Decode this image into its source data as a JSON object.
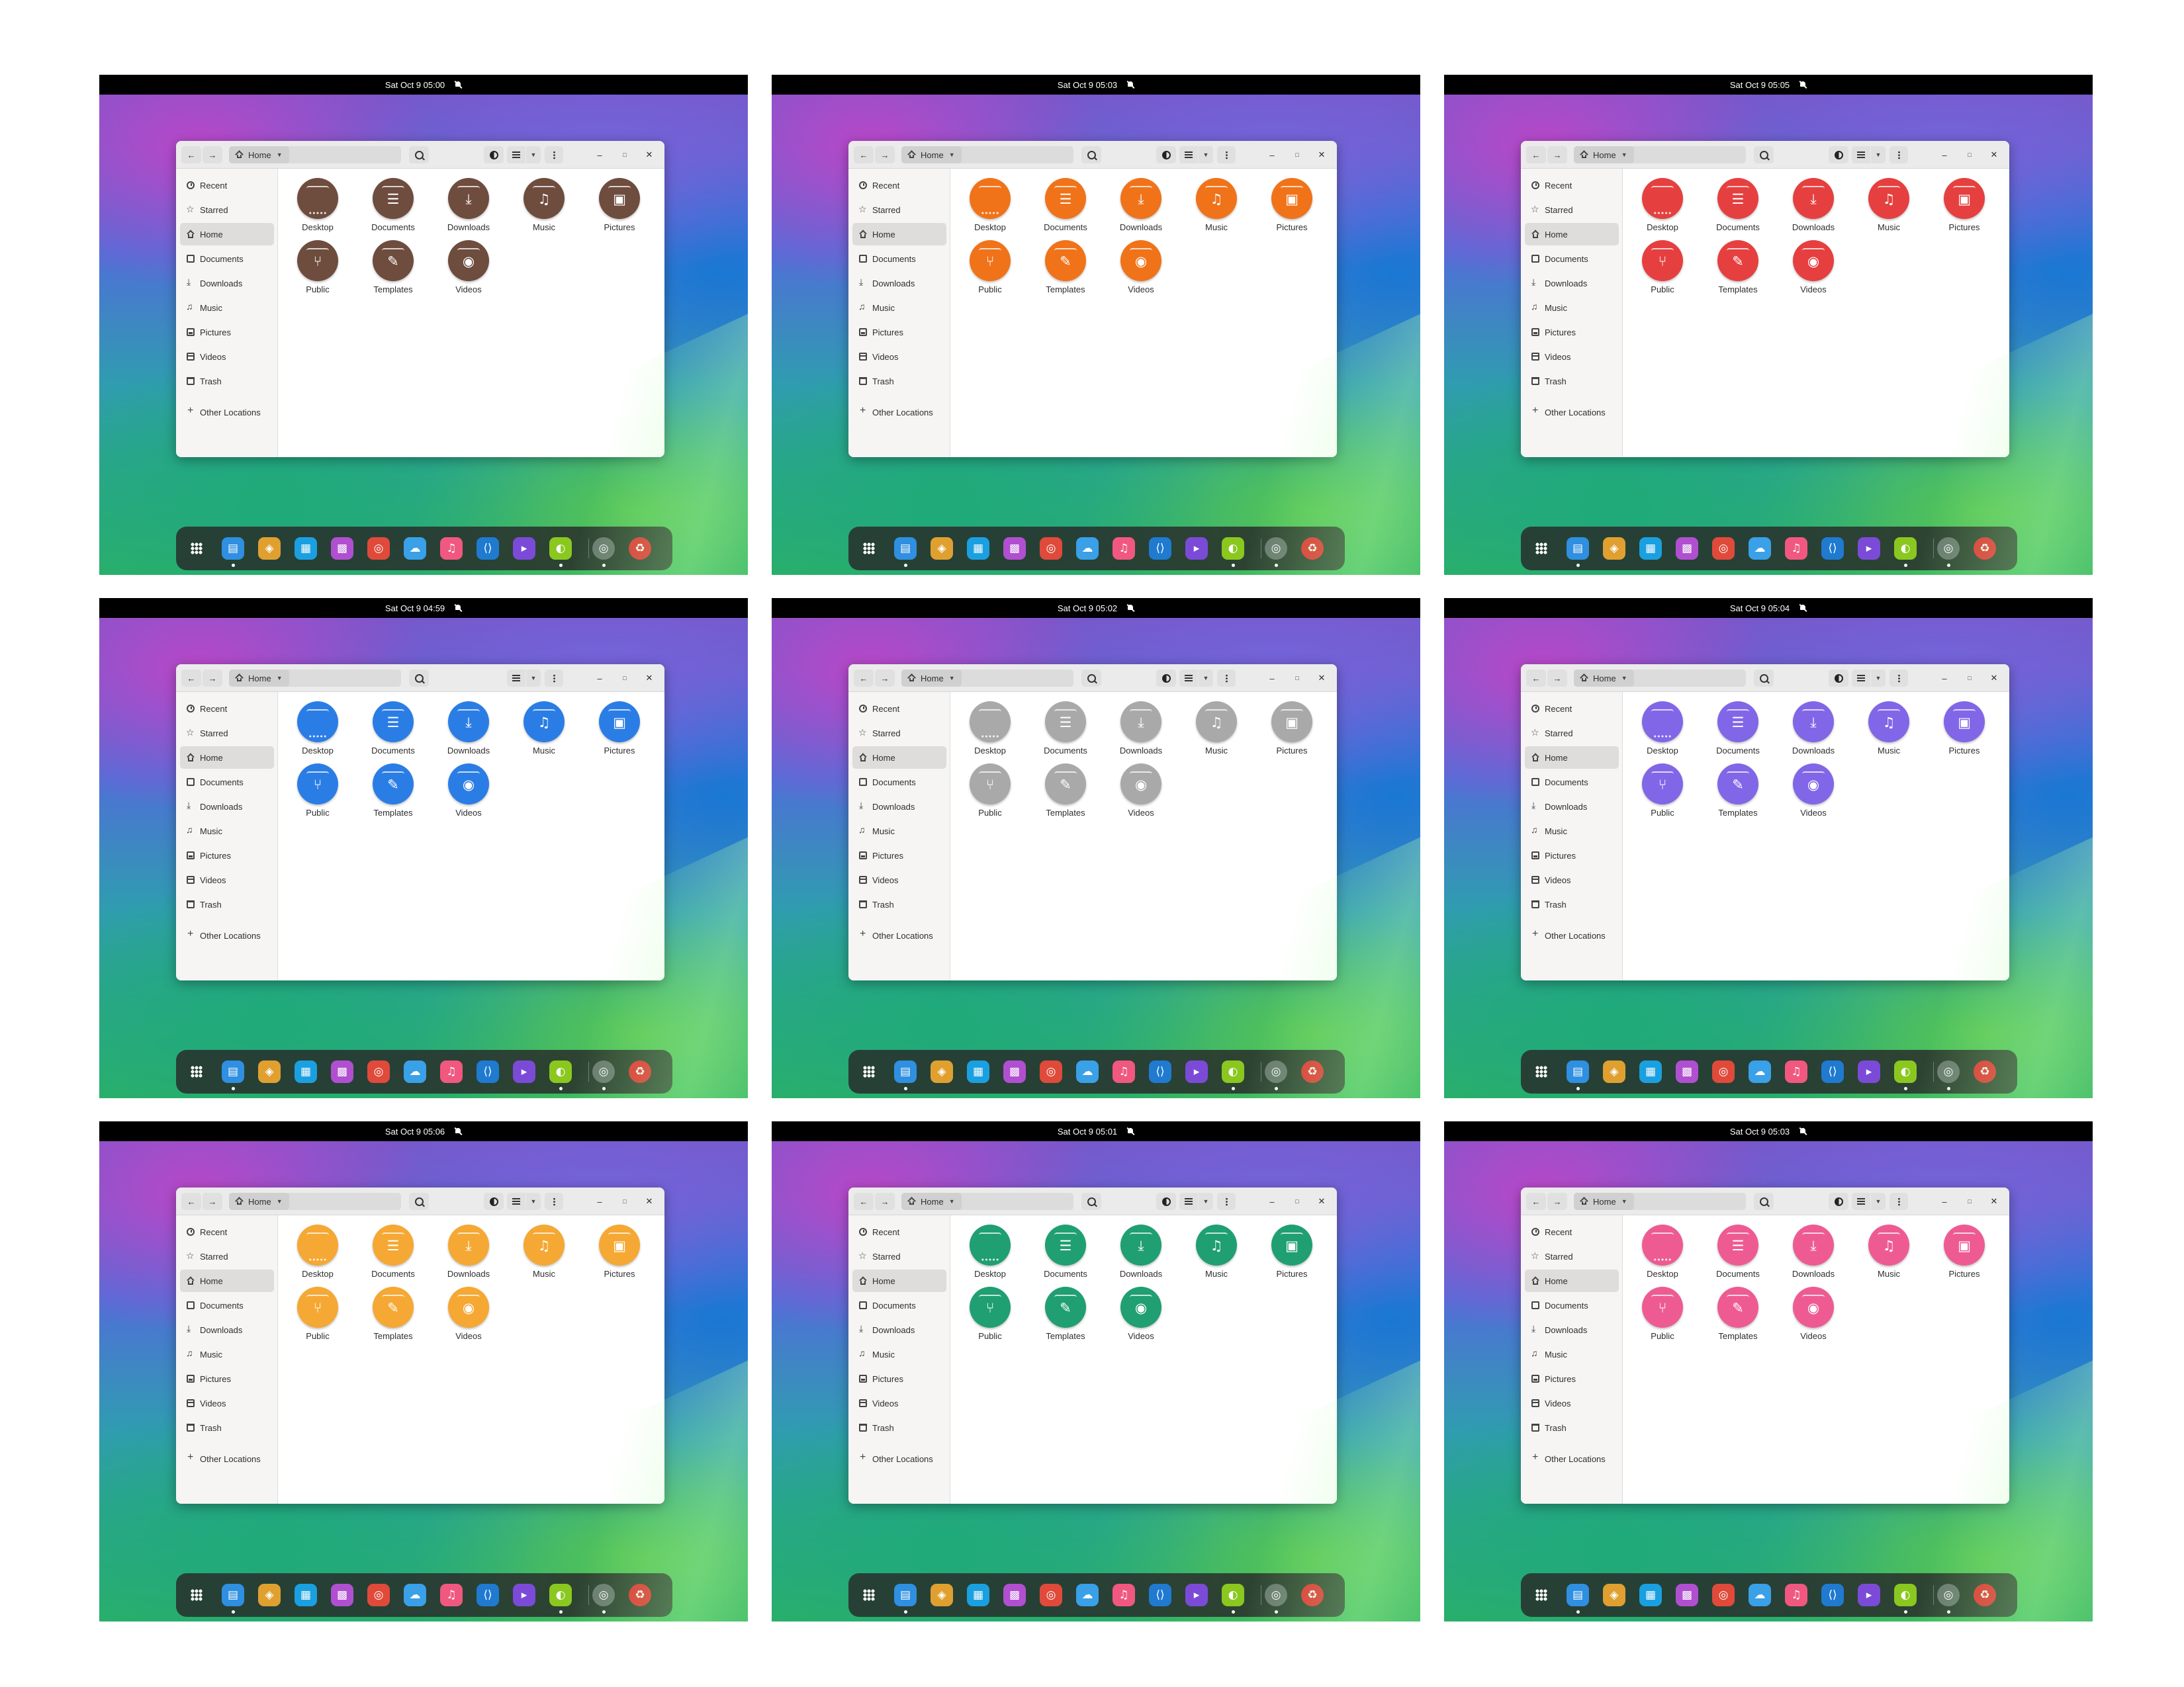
{
  "header": {
    "home_label": "Home",
    "button_icons": [
      "back-arrow-icon",
      "forward-arrow-icon",
      "search-icon",
      "contrast-icon",
      "list-view-icon",
      "menu-dots-icon",
      "minimize-icon",
      "maximize-icon",
      "close-icon"
    ]
  },
  "sidebar": {
    "items": [
      {
        "label": "Recent",
        "icon": "clock-icon"
      },
      {
        "label": "Starred",
        "icon": "star-icon"
      },
      {
        "label": "Home",
        "icon": "home-icon"
      },
      {
        "label": "Documents",
        "icon": "document-icon"
      },
      {
        "label": "Downloads",
        "icon": "download-icon"
      },
      {
        "label": "Music",
        "icon": "music-icon"
      },
      {
        "label": "Pictures",
        "icon": "picture-icon"
      },
      {
        "label": "Videos",
        "icon": "video-icon"
      },
      {
        "label": "Trash",
        "icon": "trash-icon"
      }
    ],
    "other_locations": "Other Locations"
  },
  "folders": [
    {
      "label": "Desktop",
      "icon": "desktop-folder-icon"
    },
    {
      "label": "Documents",
      "icon": "documents-folder-icon"
    },
    {
      "label": "Downloads",
      "icon": "downloads-folder-icon"
    },
    {
      "label": "Music",
      "icon": "music-folder-icon"
    },
    {
      "label": "Pictures",
      "icon": "pictures-folder-icon"
    },
    {
      "label": "Public",
      "icon": "share-folder-icon"
    },
    {
      "label": "Templates",
      "icon": "templates-folder-icon"
    },
    {
      "label": "Videos",
      "icon": "videos-folder-icon"
    }
  ],
  "dock": {
    "apps": [
      {
        "name": "app-grid-icon",
        "color": "#3a3a3a",
        "running": false
      },
      {
        "name": "files-icon",
        "color": "#2f8fe0",
        "running": true
      },
      {
        "name": "maps-icon",
        "color": "#e0a030",
        "running": false
      },
      {
        "name": "software-icon",
        "color": "#1aa0e0",
        "running": false
      },
      {
        "name": "calendar-icon",
        "color": "#b050d0",
        "running": false
      },
      {
        "name": "chrome-icon",
        "color": "#e04a3a",
        "running": false
      },
      {
        "name": "weather-icon",
        "color": "#3aa0e8",
        "running": false
      },
      {
        "name": "music-player-icon",
        "color": "#f05880",
        "running": false
      },
      {
        "name": "vscode-icon",
        "color": "#1f7ad0",
        "running": false
      },
      {
        "name": "terminal-icon",
        "color": "#7b4bd8",
        "running": false
      },
      {
        "name": "disk-usage-icon",
        "color": "#8ac820",
        "running": true
      },
      {
        "name": "settings-icon",
        "color": "#6a7a70",
        "running": true
      },
      {
        "name": "trash-can-icon",
        "color": "#e03030",
        "running": false
      }
    ]
  },
  "screens": [
    {
      "time": "Sat Oct 9  05:00",
      "folder_color": "#6e4c3e",
      "contrast_button": true
    },
    {
      "time": "Sat Oct 9  05:03",
      "folder_color": "#f0731a",
      "contrast_button": true
    },
    {
      "time": "Sat Oct 9  05:05",
      "folder_color": "#e5403f",
      "contrast_button": true
    },
    {
      "time": "Sat Oct 9  04:59",
      "folder_color": "#2b7de6",
      "contrast_button": false
    },
    {
      "time": "Sat Oct 9  05:02",
      "folder_color": "#a9a9a9",
      "contrast_button": true
    },
    {
      "time": "Sat Oct 9  05:04",
      "folder_color": "#8166e8",
      "contrast_button": true
    },
    {
      "time": "Sat Oct 9  05:06",
      "folder_color": "#f5a833",
      "contrast_button": true
    },
    {
      "time": "Sat Oct 9  05:01",
      "folder_color": "#1f9f72",
      "contrast_button": true
    },
    {
      "time": "Sat Oct 9  05:03",
      "folder_color": "#ee5b93",
      "contrast_button": true
    }
  ]
}
